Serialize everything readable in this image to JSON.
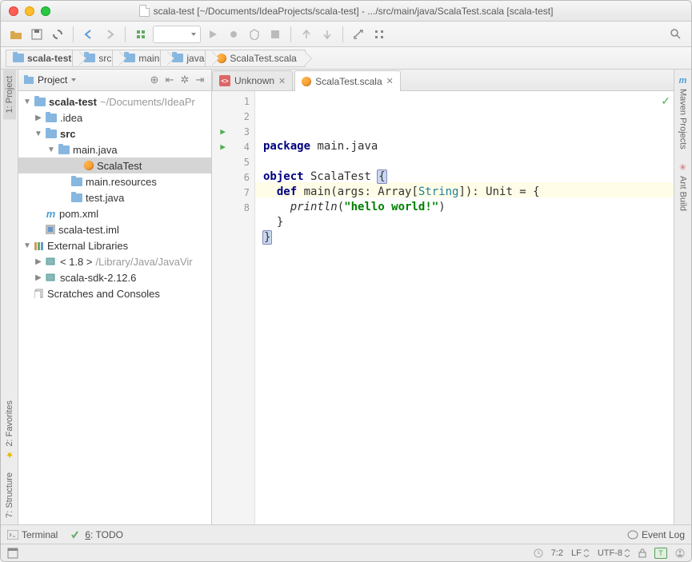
{
  "window": {
    "title": "scala-test [~/Documents/IdeaProjects/scala-test] - .../src/main/java/ScalaTest.scala [scala-test]"
  },
  "breadcrumbs": [
    {
      "label": "scala-test",
      "icon": "folder"
    },
    {
      "label": "src",
      "icon": "folder"
    },
    {
      "label": "main",
      "icon": "folder"
    },
    {
      "label": "java",
      "icon": "folder"
    },
    {
      "label": "ScalaTest.scala",
      "icon": "scala"
    }
  ],
  "project_panel": {
    "title": "Project",
    "items": [
      {
        "label": "scala-test",
        "path": "~/Documents/IdeaPr",
        "icon": "folder",
        "bold": true,
        "expand": "open",
        "indent": 0
      },
      {
        "label": ".idea",
        "icon": "folder",
        "expand": "closed",
        "indent": 1
      },
      {
        "label": "src",
        "icon": "folder",
        "bold": true,
        "expand": "open",
        "indent": 1
      },
      {
        "label": "main.java",
        "icon": "folder",
        "expand": "open",
        "indent": 2
      },
      {
        "label": "ScalaTest",
        "icon": "scala",
        "indent": 4,
        "selected": true
      },
      {
        "label": "main.resources",
        "icon": "folder",
        "indent": 3
      },
      {
        "label": "test.java",
        "icon": "folder",
        "indent": 3
      },
      {
        "label": "pom.xml",
        "icon": "maven",
        "indent": 1
      },
      {
        "label": "scala-test.iml",
        "icon": "iml",
        "indent": 1
      },
      {
        "label": "External Libraries",
        "icon": "lib",
        "expand": "open",
        "indent": 0
      },
      {
        "label": "< 1.8 >",
        "path": "/Library/Java/JavaVir",
        "icon": "jdk",
        "expand": "closed",
        "indent": 1
      },
      {
        "label": "scala-sdk-2.12.6",
        "icon": "jdk",
        "expand": "closed",
        "indent": 1
      },
      {
        "label": "Scratches and Consoles",
        "icon": "scratch",
        "indent": 0
      }
    ]
  },
  "editor_tabs": [
    {
      "label": "Unknown",
      "icon": "js",
      "active": false
    },
    {
      "label": "ScalaTest.scala",
      "icon": "scala",
      "active": true
    }
  ],
  "code": {
    "lines": [
      1,
      2,
      3,
      4,
      5,
      6,
      7,
      8
    ],
    "run_markers_at": [
      3,
      4
    ],
    "cursor_line_index": 6,
    "tokens": {
      "l1_kw": "package",
      "l1_rest": " main.java",
      "l3_kw": "object",
      "l3_name": " ScalaTest ",
      "l3_brace": "{",
      "l4_indent": "  ",
      "l4_kw": "def",
      "l4_sig1": " main(args: Array[",
      "l4_cls": "String",
      "l4_sig2": "]): Unit = {",
      "l5_indent": "    ",
      "l5_fn": "println",
      "l5_paren1": "(",
      "l5_str": "\"hello world!\"",
      "l5_paren2": ")",
      "l6": "  }",
      "l7_brace": "}"
    }
  },
  "left_rail": [
    {
      "label": "1: Project",
      "active": true
    },
    {
      "label": "2: Favorites"
    },
    {
      "label": "7: Structure"
    }
  ],
  "right_rail": [
    {
      "label": "Maven Projects",
      "icon": "m"
    },
    {
      "label": "Ant Build"
    }
  ],
  "bottom_tabs": {
    "terminal": "Terminal",
    "todo_prefix": "6",
    "todo_rest": ": TODO",
    "event_log": "Event Log"
  },
  "statusbar": {
    "cursor": "7:2",
    "line_end": "LF",
    "encoding": "UTF-8",
    "lock": "T"
  }
}
